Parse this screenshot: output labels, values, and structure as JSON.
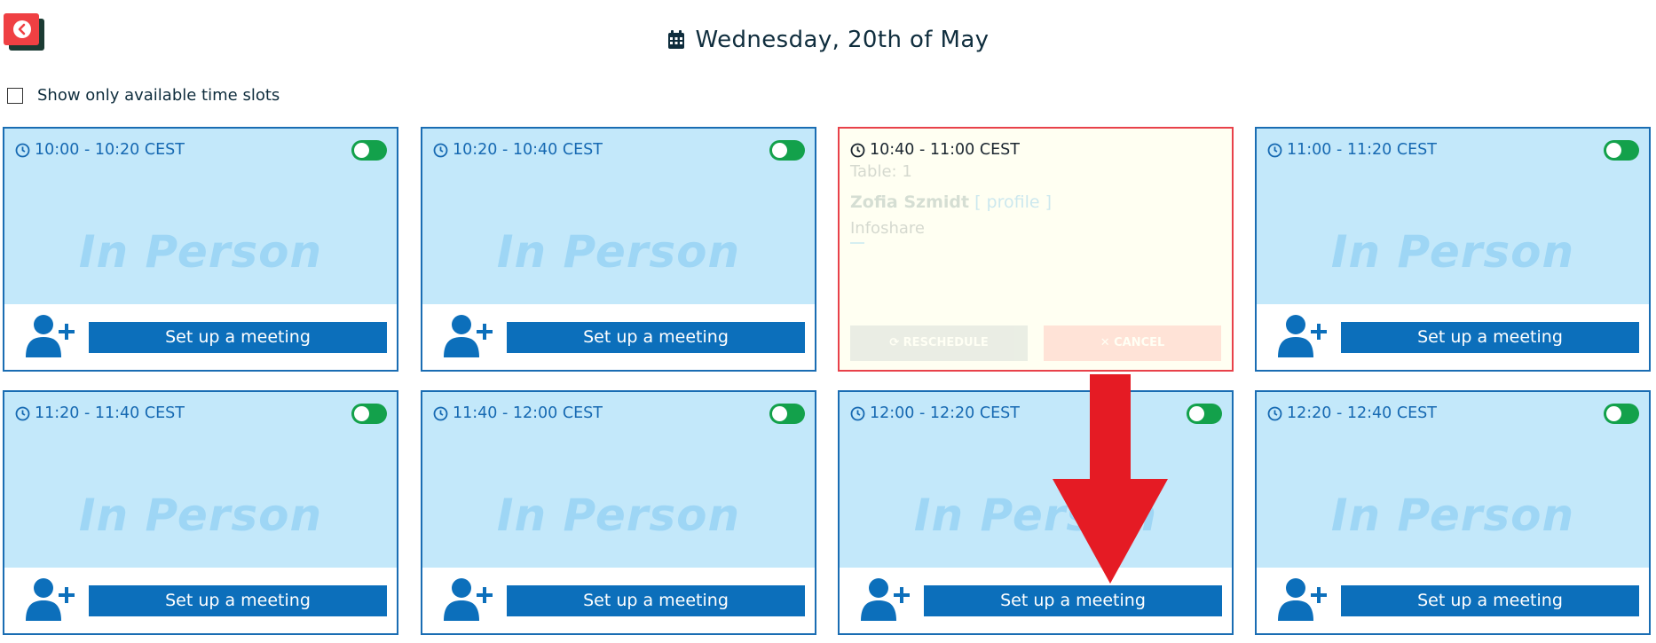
{
  "header": {
    "date_title": "Wednesday, 20th of May"
  },
  "filter": {
    "label": "Show only available time slots",
    "checked": false
  },
  "slots": [
    {
      "time": "10:00 - 10:20 CEST",
      "watermark": "In Person",
      "action": "Set up a meeting",
      "available": true
    },
    {
      "time": "10:20 - 10:40 CEST",
      "watermark": "In Person",
      "action": "Set up a meeting",
      "available": true
    },
    {
      "time": "10:40 - 11:00 CEST",
      "table": "Table: 1",
      "attendee": "Zofia Szmidt",
      "profile_link": "[ profile ]",
      "company": "Infoshare",
      "badge": "",
      "reschedule_label": "RESCHEDULE",
      "cancel_label": "CANCEL",
      "available": false
    },
    {
      "time": "11:00 - 11:20 CEST",
      "watermark": "In Person",
      "action": "Set up a meeting",
      "available": true
    },
    {
      "time": "11:20 - 11:40 CEST",
      "watermark": "In Person",
      "action": "Set up a meeting",
      "available": true
    },
    {
      "time": "11:40 - 12:00 CEST",
      "watermark": "In Person",
      "action": "Set up a meeting",
      "available": true
    },
    {
      "time": "12:00 - 12:20 CEST",
      "watermark": "In Person",
      "action": "Set up a meeting",
      "available": true
    },
    {
      "time": "12:20 - 12:40 CEST",
      "watermark": "In Person",
      "action": "Set up a meeting",
      "available": true
    }
  ],
  "colors": {
    "card_border": "#1a6db3",
    "card_bg": "#c3e8fa",
    "button_bg": "#0c6fbb",
    "toggle_on": "#13a14b",
    "booked_border": "#e8414a",
    "annotation_arrow": "#e51b24"
  }
}
